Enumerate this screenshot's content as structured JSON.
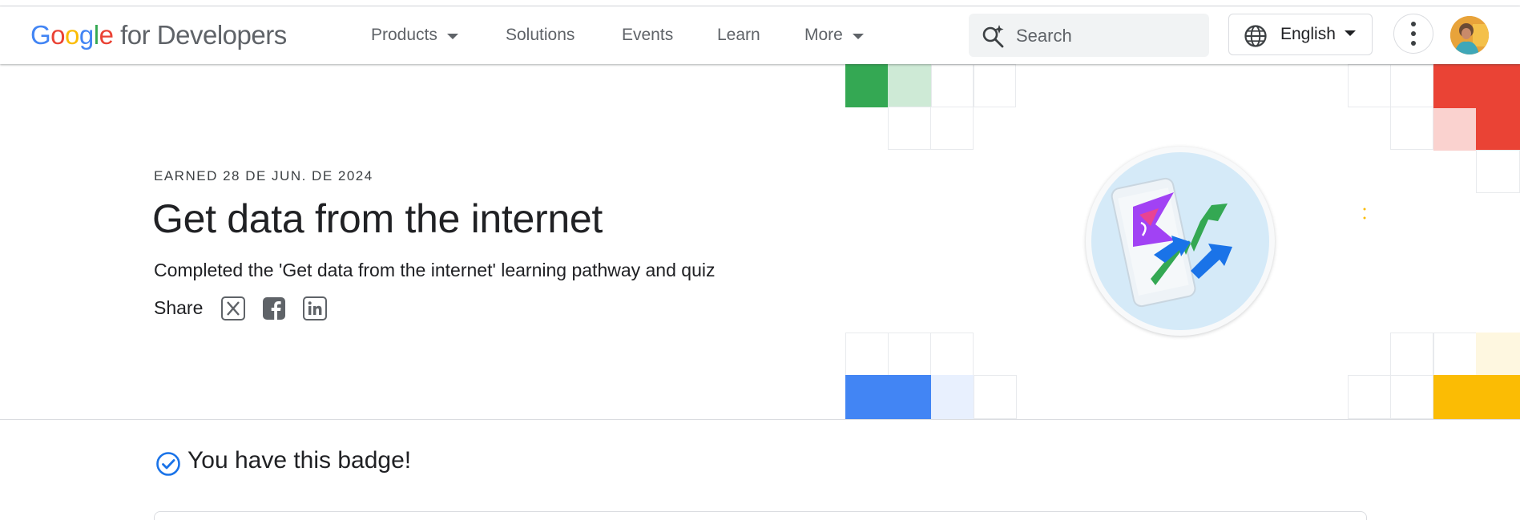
{
  "header": {
    "logo": {
      "g1": "G",
      "g2": "o",
      "g3": "o",
      "g4": "g",
      "g5": "l",
      "g6": "e",
      "rest": " for Developers"
    },
    "nav": [
      {
        "label": "Products",
        "has_caret": true
      },
      {
        "label": "Solutions",
        "has_caret": false
      },
      {
        "label": "Events",
        "has_caret": false
      },
      {
        "label": "Learn",
        "has_caret": false
      },
      {
        "label": "More",
        "has_caret": true
      }
    ],
    "search_placeholder": "Search",
    "language": "English",
    "search_icon": "search-sparkle-icon",
    "language_icon": "globe-icon",
    "menu_icon": "more-vert-icon"
  },
  "hero": {
    "earned": "EARNED 28 DE JUN. DE 2024",
    "title": "Get data from the internet",
    "description": "Completed the 'Get data from the internet' learning pathway and quiz",
    "share_label": "Share",
    "share_icons": [
      "x-icon",
      "facebook-icon",
      "linkedin-icon"
    ]
  },
  "badge_status": "You have this badge!",
  "colors": {
    "green": "#34a853",
    "green_light": "#ceead6",
    "red": "#ea4335",
    "red_light": "#fad2cf",
    "blue": "#4285f4",
    "blue_light": "#e8f0fe",
    "yellow": "#fbbc04",
    "yellow_light": "#fef7e0",
    "check_blue": "#1a73e8"
  }
}
